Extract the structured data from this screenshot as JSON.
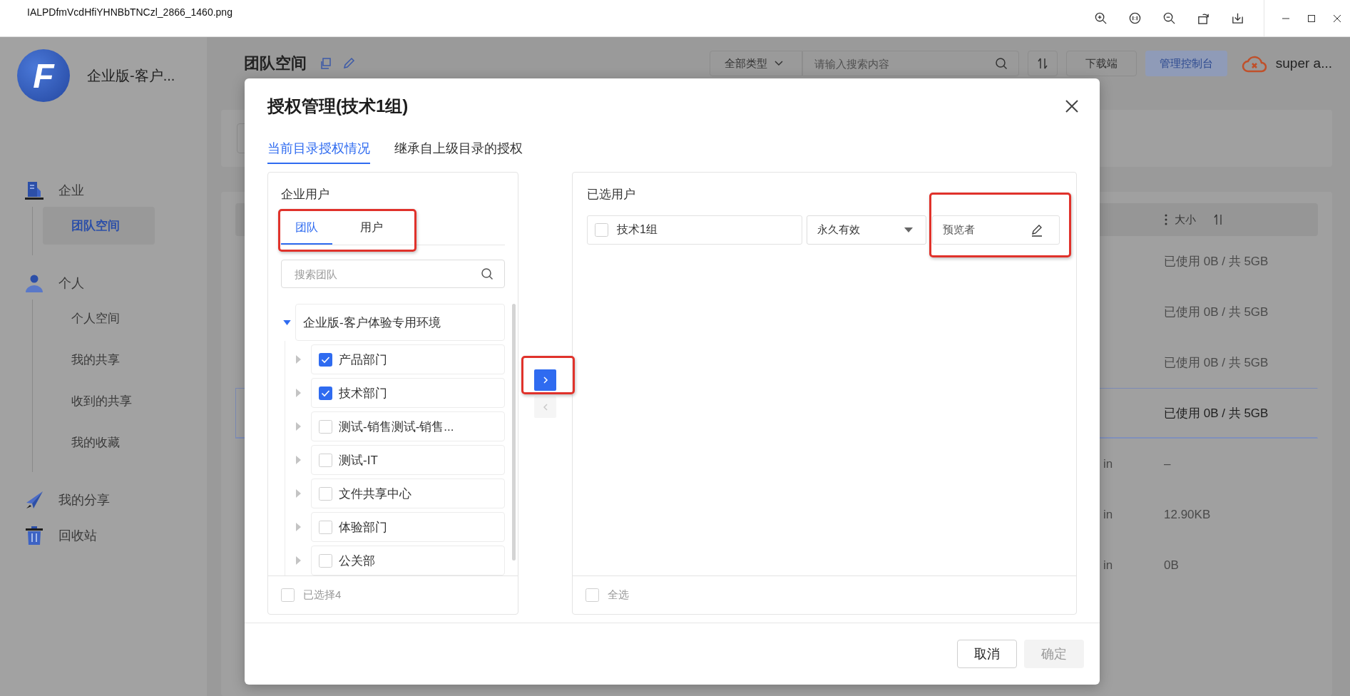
{
  "viewer": {
    "filename": "IALPDfmVcdHfiYHNBbTNCzl_2866_1460.png"
  },
  "app": {
    "logo_text": "F",
    "brand": "企业版-客户...",
    "page_title": "团队空间",
    "type_filter": "全部类型",
    "search": {
      "placeholder": "请输入搜索内容"
    },
    "download_button": "下载端",
    "console_button": "管理控制台",
    "user": "super a..."
  },
  "sidebar": {
    "items": [
      {
        "label": "企业",
        "selected": false,
        "children": [
          {
            "label": "团队空间",
            "selected": true
          }
        ]
      },
      {
        "label": "个人",
        "selected": false,
        "children": [
          {
            "label": "个人空间",
            "selected": false
          },
          {
            "label": "我的共享",
            "selected": false
          },
          {
            "label": "收到的共享",
            "selected": false
          },
          {
            "label": "我的收藏",
            "selected": false
          }
        ]
      },
      {
        "label": "我的分享",
        "selected": false
      },
      {
        "label": "回收站",
        "selected": false
      }
    ]
  },
  "table": {
    "size_header": "大小",
    "rows": [
      {
        "size": "已使用 0B / 共 5GB",
        "selected": false
      },
      {
        "size": "已使用 0B / 共 5GB",
        "selected": false
      },
      {
        "size": "已使用 0B / 共 5GB",
        "selected": false
      },
      {
        "size": "已使用 0B / 共 5GB",
        "selected": true
      },
      {
        "column_2": "in",
        "size": "–",
        "selected": false
      },
      {
        "column_2": "in",
        "size": "12.90KB",
        "selected": false
      },
      {
        "column_2": "in",
        "size": "0B",
        "selected": false
      }
    ]
  },
  "dialog": {
    "title": "授权管理(技术1组)",
    "tabs": [
      {
        "label": "当前目录授权情况",
        "selected": true
      },
      {
        "label": "继承自上级目录的授权",
        "selected": false
      }
    ],
    "source": {
      "title": "企业用户",
      "tabs_highlighted": true,
      "tabs": [
        {
          "label": "团队",
          "selected": true
        },
        {
          "label": "用户",
          "selected": false
        }
      ],
      "search": {
        "placeholder": "搜索团队"
      },
      "tree": [
        {
          "label": "企业版-客户体验专用环境",
          "expanded": true,
          "children": [
            {
              "label": "产品部门",
              "checked": true,
              "expanded": false
            },
            {
              "label": "技术部门",
              "checked": true,
              "expanded": false
            },
            {
              "label": "测试-销售测试-销售...",
              "checked": false,
              "expanded": false
            },
            {
              "label": "测试-IT",
              "checked": false,
              "expanded": false
            },
            {
              "label": "文件共享中心",
              "checked": false,
              "expanded": false
            },
            {
              "label": "体验部门",
              "checked": false,
              "expanded": false
            },
            {
              "label": "公关部",
              "checked": false,
              "expanded": false
            }
          ]
        }
      ],
      "footer": {
        "label": "已选择4",
        "checked": false
      }
    },
    "transfer": {
      "highlighted": true,
      "add_disabled": false,
      "remove_disabled": true
    },
    "target": {
      "title": "已选用户",
      "rows": [
        {
          "name": "技术1组",
          "checked": false,
          "validity": "永久有效",
          "role": "预览者",
          "role_highlighted": true
        }
      ],
      "footer": {
        "label": "全选",
        "checked": false
      }
    },
    "buttons": [
      {
        "label": "取消",
        "kind": "secondary",
        "disabled": false
      },
      {
        "label": "确定",
        "kind": "primary",
        "disabled": true
      }
    ]
  }
}
